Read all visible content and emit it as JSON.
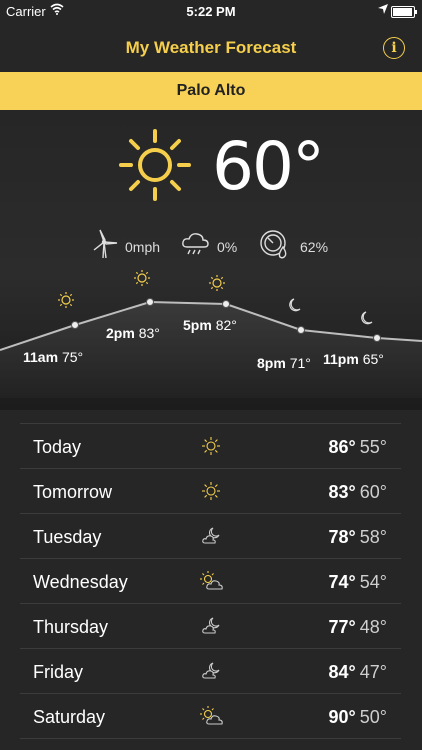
{
  "status": {
    "carrier": "Carrier",
    "time": "5:22 PM",
    "battery_level": 0.95
  },
  "header": {
    "title": "My Weather Forecast",
    "info_label": "i"
  },
  "location": "Palo Alto",
  "current": {
    "condition_icon": "sun-icon",
    "temperature": "60°",
    "wind": "0mph",
    "precipitation": "0%",
    "humidity": "62%"
  },
  "hourly": [
    {
      "time": "11am",
      "temp": "75°",
      "icon": "sun-icon"
    },
    {
      "time": "2pm",
      "temp": "83°",
      "icon": "sun-icon"
    },
    {
      "time": "5pm",
      "temp": "82°",
      "icon": "sun-icon"
    },
    {
      "time": "8pm",
      "temp": "71°",
      "icon": "moon-icon"
    },
    {
      "time": "11pm",
      "temp": "65°",
      "icon": "moon-icon"
    }
  ],
  "daily": [
    {
      "day": "Today",
      "icon": "sun-icon",
      "high": "86°",
      "low": "55°"
    },
    {
      "day": "Tomorrow",
      "icon": "sun-icon",
      "high": "83°",
      "low": "60°"
    },
    {
      "day": "Tuesday",
      "icon": "partly-cloudy-night-icon",
      "high": "78°",
      "low": "58°"
    },
    {
      "day": "Wednesday",
      "icon": "partly-cloudy-icon",
      "high": "74°",
      "low": "54°"
    },
    {
      "day": "Thursday",
      "icon": "partly-cloudy-night-icon",
      "high": "77°",
      "low": "48°"
    },
    {
      "day": "Friday",
      "icon": "partly-cloudy-night-icon",
      "high": "84°",
      "low": "47°"
    },
    {
      "day": "Saturday",
      "icon": "partly-cloudy-icon",
      "high": "90°",
      "low": "50°"
    }
  ],
  "colors": {
    "accent": "#f5cf4b",
    "location_bar": "#f8d257",
    "background": "#262626"
  }
}
